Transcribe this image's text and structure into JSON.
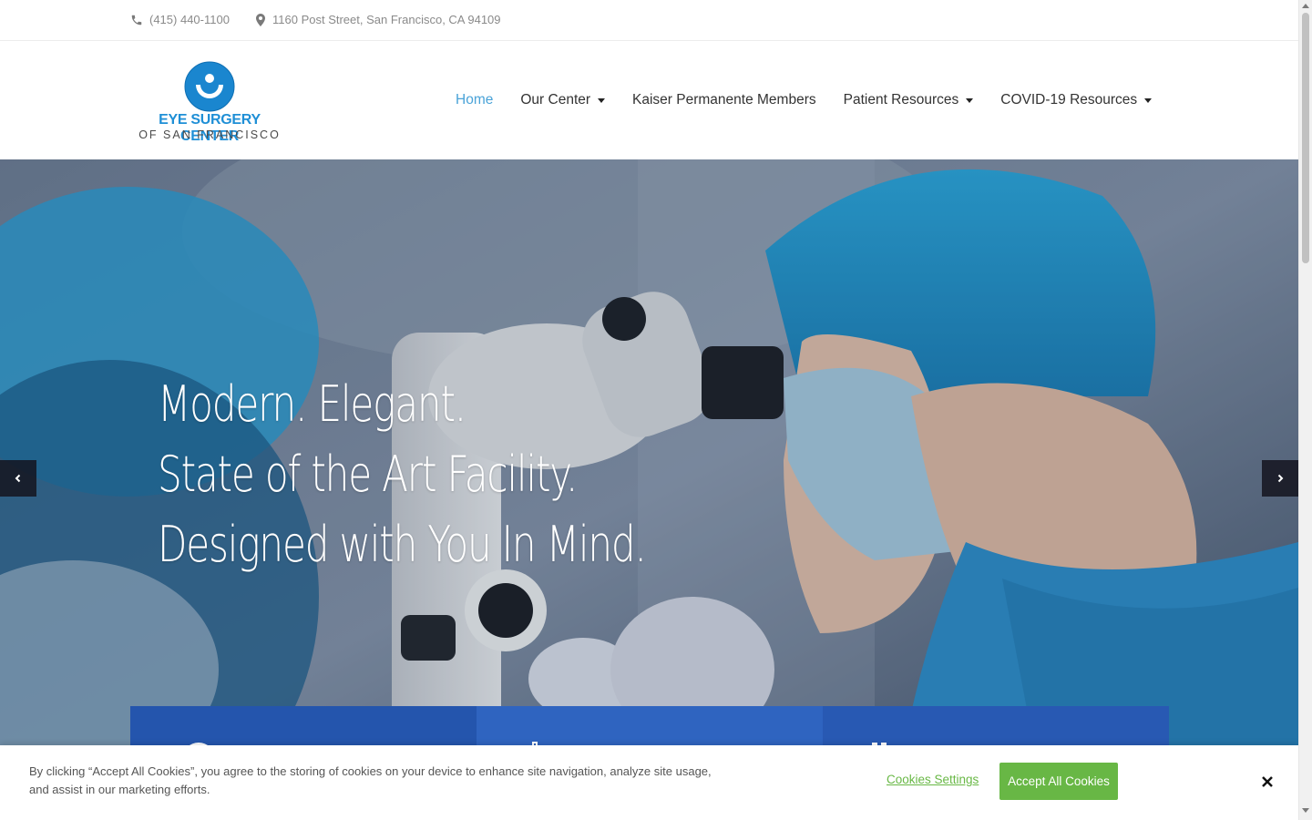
{
  "topbar": {
    "phone": "(415) 440-1100",
    "address": "1160 Post Street, San Francisco, CA 94109",
    "phone_icon": "phone-icon",
    "address_icon": "map-pin-icon"
  },
  "logo": {
    "line1": "EYE SURGERY CENTER",
    "line2": "OF SAN FRANCISCO"
  },
  "nav": {
    "items": [
      {
        "label": "Home",
        "active": true,
        "dropdown": false
      },
      {
        "label": "Our Center",
        "active": false,
        "dropdown": true
      },
      {
        "label": "Kaiser Permanente Members",
        "active": false,
        "dropdown": false
      },
      {
        "label": "Patient Resources",
        "active": false,
        "dropdown": true
      },
      {
        "label": "COVID-19 Resources",
        "active": false,
        "dropdown": true
      }
    ]
  },
  "hero": {
    "lines": [
      "Modern. Elegant.",
      "State of the Art Facility.",
      "Designed with You In Mind."
    ],
    "prev_icon": "chevron-left-icon",
    "next_icon": "chevron-right-icon"
  },
  "cookie": {
    "text": "By clicking “Accept All Cookies”, you agree to the storing of cookies on your device to enhance site navigation, analyze site usage, and assist in our marketing efforts.",
    "settings_label": "Cookies Settings",
    "accept_label": "Accept All Cookies",
    "close_icon": "close-icon"
  },
  "colors": {
    "accent": "#4aa3d8",
    "brand_blue": "#1f8fd6",
    "feature_blue": "#2455ad",
    "cookie_green": "#68b745"
  }
}
